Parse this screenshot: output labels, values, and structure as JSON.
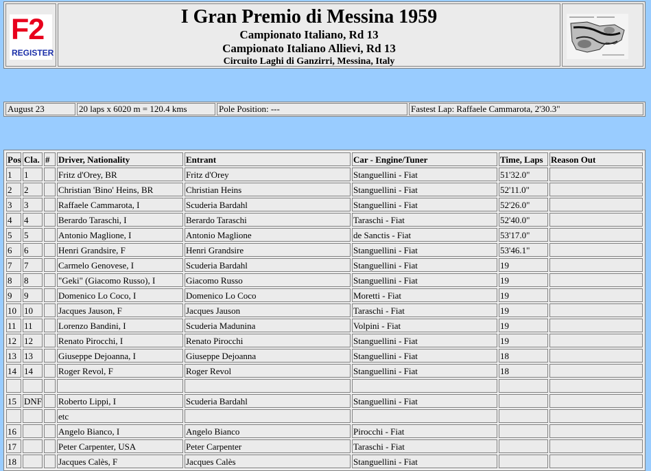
{
  "header": {
    "logo_text": "F2",
    "logo_subtext": "REGISTER",
    "title": "I Gran Premio di Messina 1959",
    "subtitle1": "Campionato Italiano, Rd 13",
    "subtitle2": "Campionato Italiano Allievi, Rd 13",
    "subtitle3": "Circuito Laghi di Ganzirri, Messina, Italy"
  },
  "info": {
    "date": "August 23",
    "distance": "20 laps x 6020 m = 120.4 kms",
    "pole": "Pole Position: ---",
    "fastest": "Fastest Lap: Raffaele Cammarota, 2'30.3\""
  },
  "table": {
    "headers": [
      "Pos",
      "Cla.",
      "#",
      "Driver, Nationality",
      "Entrant",
      "Car - Engine/Tuner",
      "Time, Laps",
      "Reason Out"
    ],
    "rows": [
      [
        "1",
        "1",
        "",
        "Fritz d'Orey, BR",
        "Fritz d'Orey",
        "Stanguellini - Fiat",
        "51'32.0\"",
        ""
      ],
      [
        "2",
        "2",
        "",
        "Christian 'Bino' Heins, BR",
        "Christian Heins",
        "Stanguellini - Fiat",
        "52'11.0\"",
        ""
      ],
      [
        "3",
        "3",
        "",
        "Raffaele Cammarota, I",
        "Scuderia Bardahl",
        "Stanguellini - Fiat",
        "52'26.0\"",
        ""
      ],
      [
        "4",
        "4",
        "",
        "Berardo Taraschi, I",
        "Berardo Taraschi",
        "Taraschi - Fiat",
        "52'40.0\"",
        ""
      ],
      [
        "5",
        "5",
        "",
        "Antonio Maglione, I",
        "Antonio Maglione",
        "de Sanctis - Fiat",
        "53'17.0\"",
        ""
      ],
      [
        "6",
        "6",
        "",
        "Henri Grandsire, F",
        "Henri Grandsire",
        "Stanguellini - Fiat",
        "53'46.1\"",
        ""
      ],
      [
        "7",
        "7",
        "",
        "Carmelo Genovese, I",
        "Scuderia Bardahl",
        "Stanguellini - Fiat",
        "19",
        ""
      ],
      [
        "8",
        "8",
        "",
        "\"Geki\" (Giacomo Russo), I",
        "Giacomo Russo",
        "Stanguellini - Fiat",
        "19",
        ""
      ],
      [
        "9",
        "9",
        "",
        "Domenico Lo Coco, I",
        "Domenico Lo Coco",
        "Moretti - Fiat",
        "19",
        ""
      ],
      [
        "10",
        "10",
        "",
        "Jacques Jauson, F",
        "Jacques Jauson",
        "Taraschi - Fiat",
        "19",
        ""
      ],
      [
        "11",
        "11",
        "",
        "Lorenzo Bandini, I",
        "Scuderia Madunina",
        "Volpini - Fiat",
        "19",
        ""
      ],
      [
        "12",
        "12",
        "",
        "Renato Pirocchi, I",
        "Renato Pirocchi",
        "Stanguellini - Fiat",
        "19",
        ""
      ],
      [
        "13",
        "13",
        "",
        "Giuseppe Dejoanna, I",
        "Giuseppe Dejoanna",
        "Stanguellini - Fiat",
        "18",
        ""
      ],
      [
        "14",
        "14",
        "",
        "Roger Revol, F",
        "Roger Revol",
        "Stanguellini - Fiat",
        "18",
        ""
      ],
      [
        "",
        "",
        "",
        "",
        "",
        "",
        "",
        ""
      ],
      [
        "15",
        "DNF",
        "",
        "Roberto Lippi, I",
        "Scuderia Bardahl",
        "Stanguellini - Fiat",
        "",
        ""
      ],
      [
        "",
        "",
        "",
        "etc",
        "",
        "",
        "",
        ""
      ],
      [
        "16",
        "",
        "",
        "Angelo Bianco, I",
        "Angelo Bianco",
        "Pirocchi - Fiat",
        "",
        ""
      ],
      [
        "17",
        "",
        "",
        "Peter Carpenter, USA",
        "Peter Carpenter",
        "Taraschi - Fiat",
        "",
        ""
      ],
      [
        "18",
        "",
        "",
        "Jacques Calès, F",
        "Jacques Calès",
        "Stanguellini - Fiat",
        "",
        ""
      ]
    ]
  }
}
